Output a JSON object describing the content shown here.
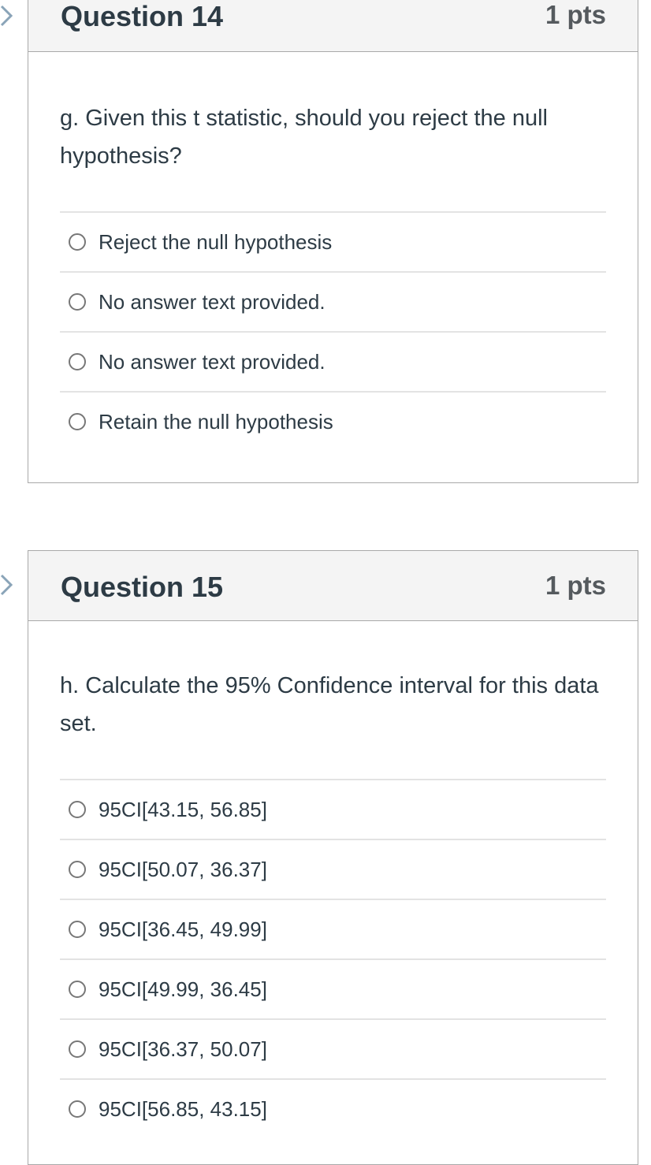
{
  "questions": [
    {
      "title": "Question 14",
      "points": "1 pts",
      "text": "g. Given this t statistic, should you reject the null hypothesis?",
      "flag_icon": "chevron-right-icon",
      "answers": [
        {
          "label": "Reject the null hypothesis",
          "selected": false
        },
        {
          "label": "No answer text provided.",
          "selected": false
        },
        {
          "label": "No answer text provided.",
          "selected": false
        },
        {
          "label": "Retain the null hypothesis",
          "selected": false
        }
      ]
    },
    {
      "title": "Question 15",
      "points": "1 pts",
      "text": "h. Calculate the 95% Confidence interval for this data set.",
      "flag_icon": "chevron-right-icon",
      "answers": [
        {
          "label": "95CI[43.15, 56.85]",
          "selected": false
        },
        {
          "label": "95CI[50.07, 36.37]",
          "selected": false
        },
        {
          "label": "95CI[36.45, 49.99]",
          "selected": false
        },
        {
          "label": "95CI[49.99, 36.45]",
          "selected": false
        },
        {
          "label": "95CI[36.37, 50.07]",
          "selected": false
        },
        {
          "label": "95CI[56.85, 43.15]",
          "selected": false
        }
      ]
    }
  ],
  "colors": {
    "text": "#2d3b45",
    "points": "#555a5e",
    "header_bg": "#f4f4f4",
    "border": "#a9a9a9",
    "divider": "#e3e3e3",
    "flag": "#8aa4b8"
  }
}
